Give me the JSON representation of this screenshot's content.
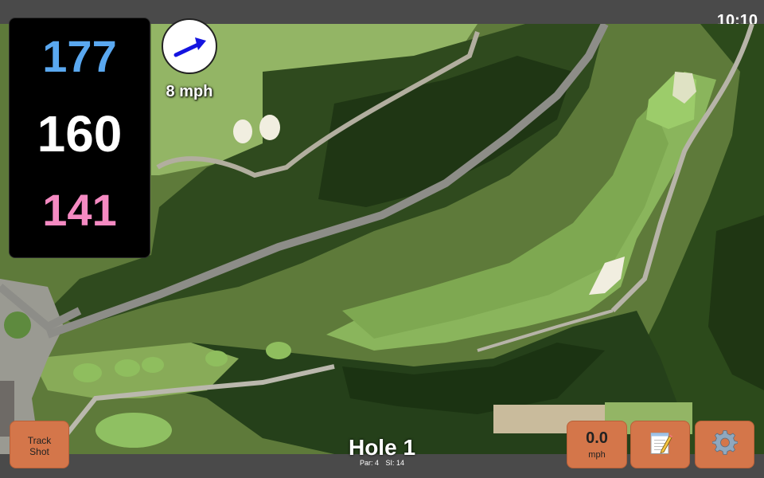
{
  "clock": "10:10",
  "distances": {
    "back": "177",
    "middle": "160",
    "front": "141",
    "colors": {
      "back": "#5aa8f0",
      "middle": "#ffffff",
      "front": "#f58ac2"
    }
  },
  "wind": {
    "speed_label": "8 mph",
    "icon": "wind-direction-arrow-icon"
  },
  "hole": {
    "title": "Hole 1",
    "par_label": "Par: 4",
    "si_label": "SI: 14"
  },
  "buttons": {
    "track_shot": {
      "line1": "Track",
      "line2": "Shot"
    },
    "speed": {
      "value": "0.0",
      "unit": "mph"
    },
    "notes_icon": "notepad-icon",
    "settings_icon": "gear-icon"
  },
  "colors": {
    "button_bg": "#d4764a",
    "bar_bg": "#4a4a4a"
  }
}
